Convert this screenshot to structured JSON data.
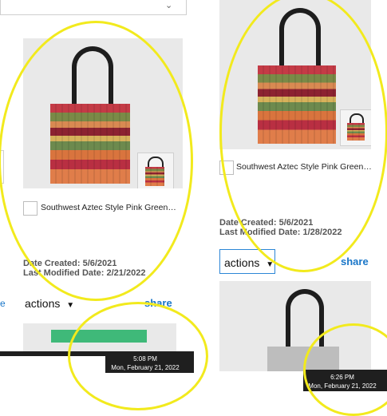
{
  "left_panel": {
    "product_title": "Southwest Aztec Style Pink Green…",
    "date_created": "Date Created: 5/6/2021",
    "last_modified": "Last Modified Date: 2/21/2022",
    "actions_label": "actions",
    "share_label": "share",
    "taskbar_time": "5:08 PM",
    "taskbar_date": "Mon, February 21, 2022"
  },
  "right_panel": {
    "product_title": "Southwest Aztec Style Pink Green…",
    "date_created": "Date Created: 5/6/2021",
    "last_modified": "Last Modified Date: 1/28/2022",
    "actions_label": "actions",
    "share_label": "share",
    "taskbar_time": "6:26 PM",
    "taskbar_date": "Mon, February 21, 2022"
  },
  "colors": {
    "annotation_ring": "#f2ea1d",
    "share_link": "#1976c8",
    "green_bar": "#3fb979",
    "taskbar": "#1f1f1f"
  },
  "icons": {
    "dropdown": "chevron-down-icon",
    "caret": "caret-down-icon"
  }
}
